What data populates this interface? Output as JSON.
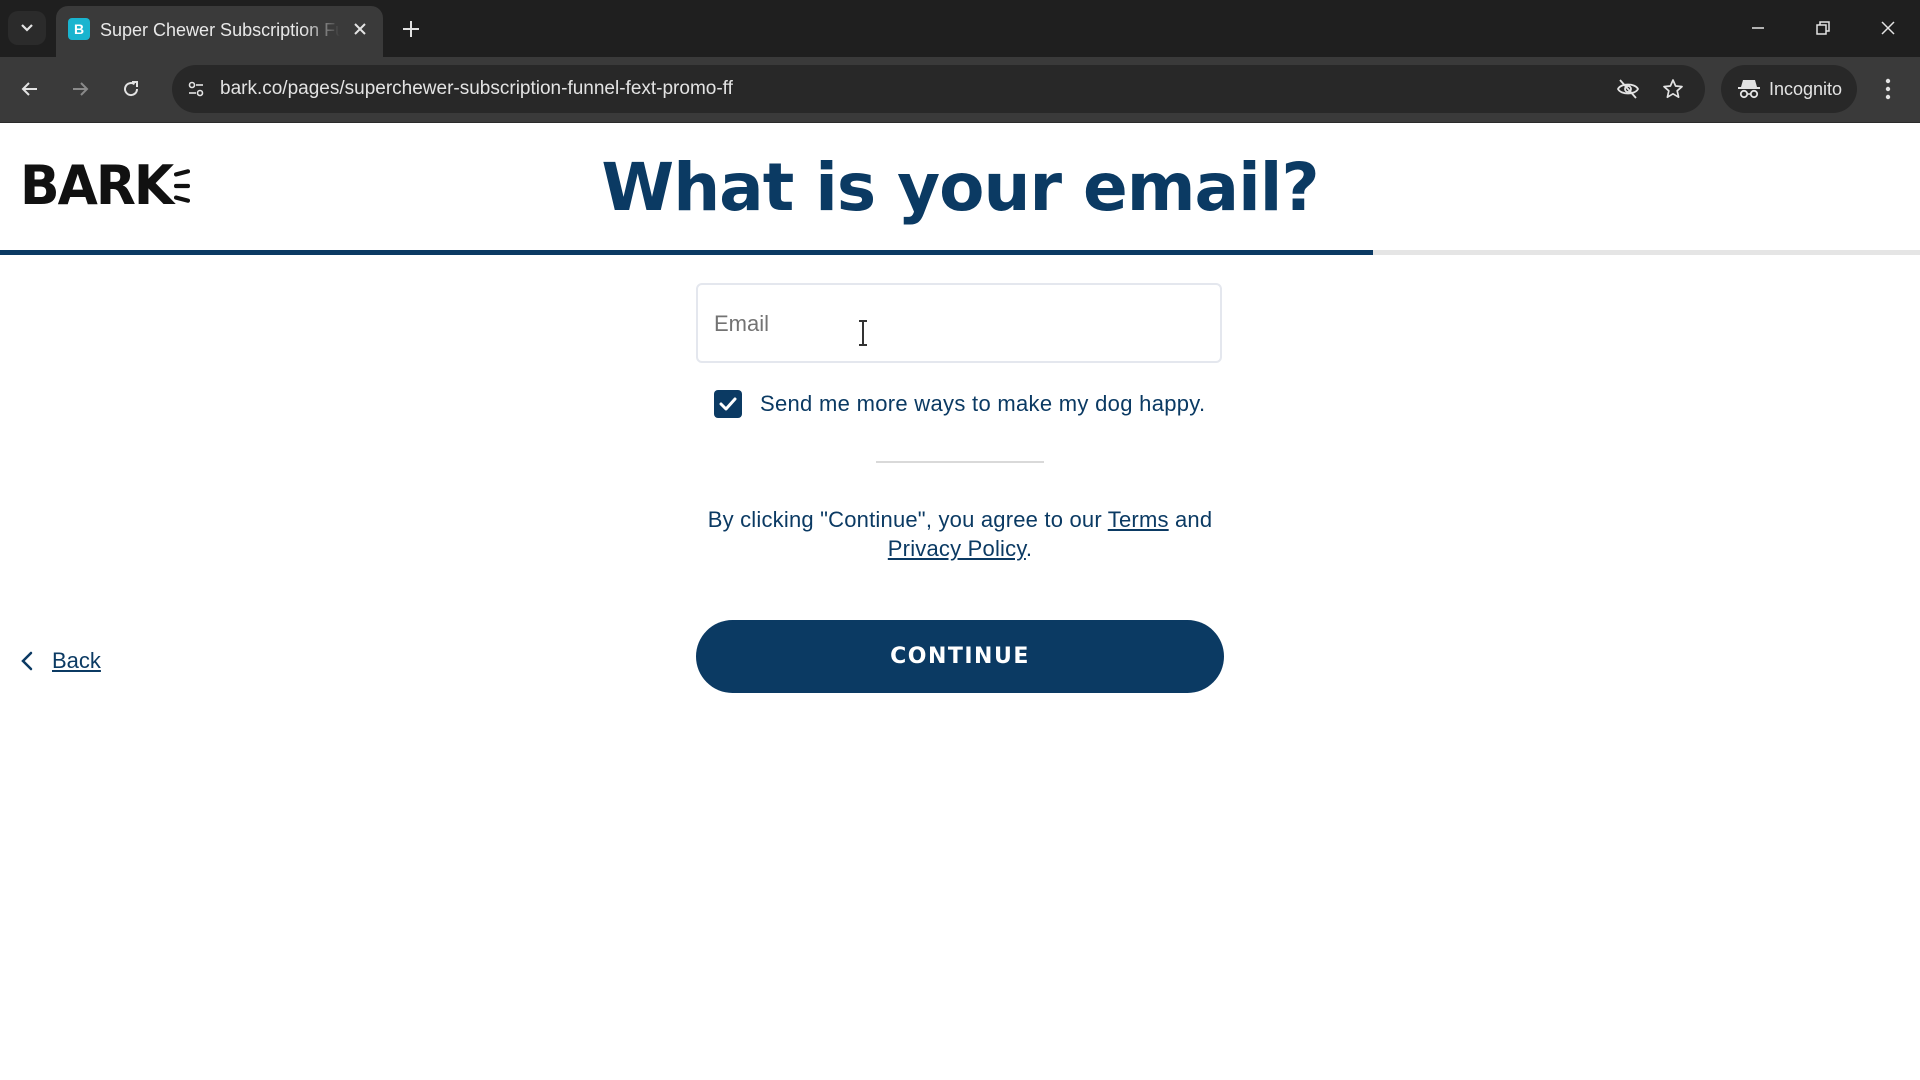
{
  "browser": {
    "tab_title": "Super Chewer Subscription Funnel",
    "favicon_letter": "B",
    "url": "bark.co/pages/superchewer-subscription-funnel-fext-promo-ff",
    "incognito_label": "Incognito",
    "icons": {
      "tab_search": "chevron-down-icon",
      "tab_close": "close-icon",
      "new_tab": "plus-icon",
      "minimize": "minimize-icon",
      "restore": "restore-icon",
      "close_window": "close-icon",
      "back": "arrow-left-icon",
      "forward": "arrow-right-icon",
      "reload": "reload-icon",
      "site_info": "tune-icon",
      "tracking": "eye-off-icon",
      "bookmark": "star-icon",
      "incognito": "incognito-icon",
      "menu": "kebab-menu-icon"
    }
  },
  "page": {
    "logo_text": "BARK",
    "title": "What is your email?",
    "progress_fraction": 0.715,
    "email": {
      "placeholder": "Email",
      "value": ""
    },
    "opt_in": {
      "checked": true,
      "label": "Send me more ways to make my dog happy."
    },
    "legal": {
      "prefix": "By clicking \"Continue\", you agree to our ",
      "terms_label": "Terms",
      "middle": " and",
      "privacy_label": "Privacy Policy",
      "suffix": "."
    },
    "back_label": "Back",
    "continue_label": "CONTINUE"
  },
  "colors": {
    "brand_navy": "#0b3a63",
    "chrome_dark": "#1f1f1f",
    "chrome_toolbar": "#3a3a3a",
    "favicon": "#19b4cf"
  }
}
